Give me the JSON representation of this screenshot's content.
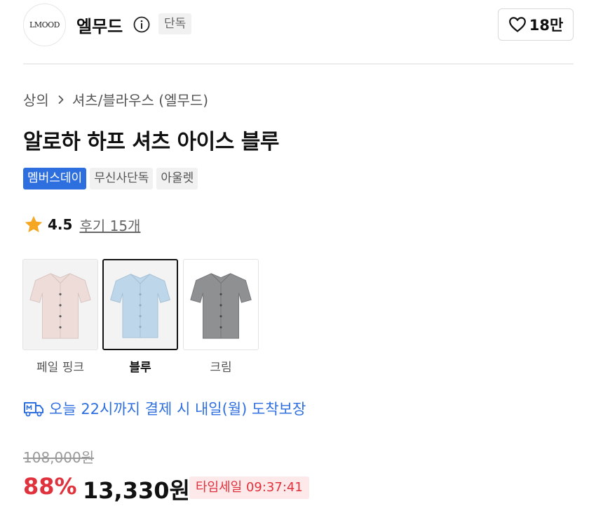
{
  "header": {
    "brand_logo_text": "LMOOD",
    "brand_name": "엘무드",
    "exclusive_badge": "단독",
    "like_count": "18만"
  },
  "breadcrumb": {
    "category": "상의",
    "subcategory": "셔츠/블라우스 (엘무드)"
  },
  "product": {
    "title": "알로하 하프 셔츠 아이스 블루",
    "tags": [
      "멤버스데이",
      "무신사단독",
      "아울렛"
    ],
    "rating": "4.5",
    "review_link": "후기 15개"
  },
  "color_options": [
    {
      "label": "페일 핑크",
      "selected": false,
      "color": "#eedcd9"
    },
    {
      "label": "블루",
      "selected": true,
      "color": "#bdd6ea"
    },
    {
      "label": "크림",
      "selected": false,
      "color": "#8f9092"
    }
  ],
  "delivery": {
    "text": "오늘 22시까지 결제 시 내일(월) 도착보장"
  },
  "price": {
    "original": "108,000원",
    "discount": "88%",
    "sale": "13,330원",
    "timesale": "타임세일 09:37:41"
  },
  "colors": {
    "accent_blue": "#2e6fe0",
    "discount_red": "#e0323c",
    "star": "#f5a623"
  },
  "icons": {
    "info": "info-icon",
    "like": "heart-icon",
    "breadcrumb_separator": "chevron-right-icon",
    "rating": "star-icon",
    "delivery": "truck-icon"
  }
}
